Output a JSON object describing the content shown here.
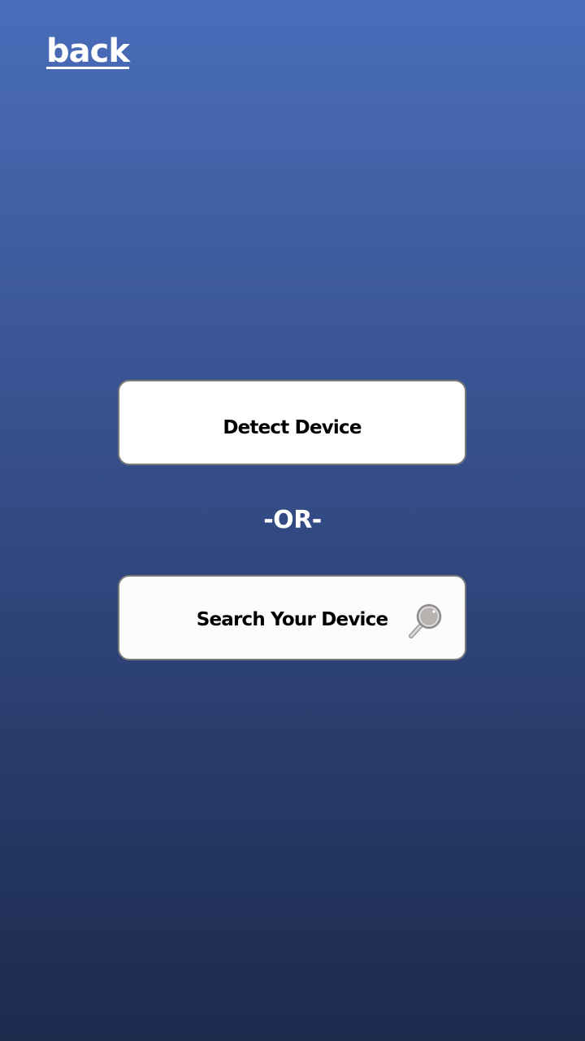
{
  "nav": {
    "back_label": "back"
  },
  "actions": {
    "detect_label": "Detect Device",
    "divider_label": "-OR-",
    "search_label": "Search Your Device",
    "search_icon": "magnifier-icon"
  },
  "colors": {
    "gradient_top": "#4a6dba",
    "gradient_bottom": "#1c2a4c",
    "button_background": "#ffffff",
    "button_border": "#7a7a7a"
  }
}
